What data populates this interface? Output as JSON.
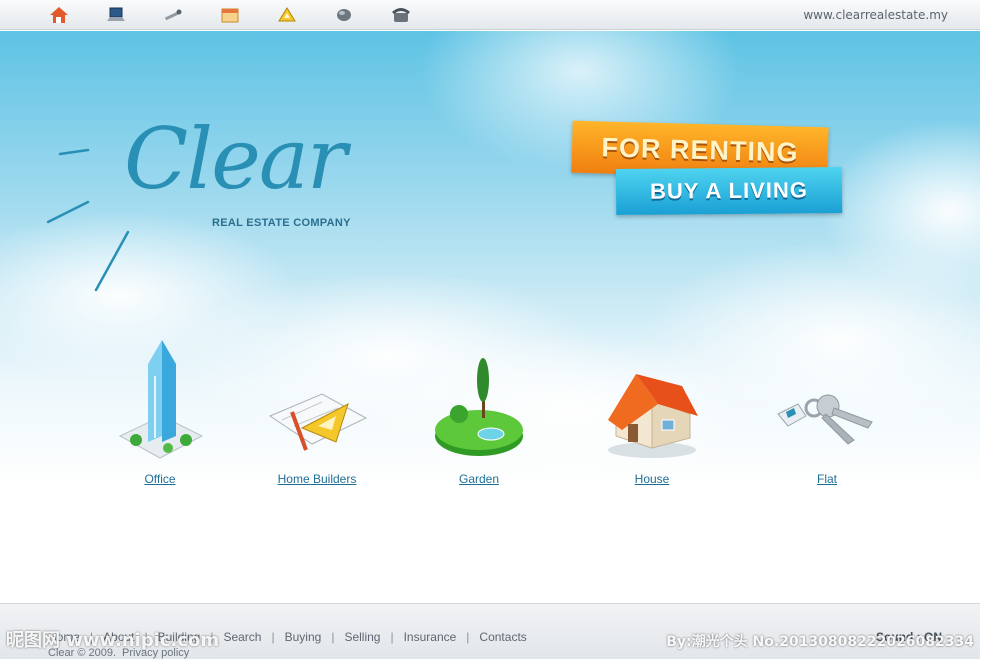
{
  "topbar": {
    "icons": [
      "home-icon",
      "laptop-icon",
      "tools-icon",
      "calendar-icon",
      "ruler-triangle-icon",
      "globe-icon",
      "phone-icon"
    ],
    "url": "www.clearrealestate.my"
  },
  "logo": {
    "word": "Clear",
    "subtitle": "REAL ESTATE COMPANY"
  },
  "banners": {
    "primary": "FOR RENTING",
    "secondary": "BUY A LIVING"
  },
  "categories": [
    {
      "label": "Office",
      "icon": "office-building-icon"
    },
    {
      "label": "Home Builders",
      "icon": "blueprint-icon"
    },
    {
      "label": "Garden",
      "icon": "garden-icon"
    },
    {
      "label": "House",
      "icon": "house-icon"
    },
    {
      "label": "Flat",
      "icon": "keys-icon"
    }
  ],
  "footer": {
    "nav": [
      "Home",
      "About",
      "Building",
      "Search",
      "Buying",
      "Selling",
      "Insurance",
      "Contacts"
    ],
    "copyright": "Clear  ©  2009.",
    "privacy": "Privacy policy",
    "sound": "Sound : ON"
  },
  "watermarks": {
    "left": "昵图网 www.nipic.com",
    "right": "By:潮光个头 No.20130808222026082334"
  },
  "colors": {
    "accent": "#2a8fb5",
    "banner_orange": "#f59a1b",
    "banner_blue": "#2bb3e0",
    "link": "#1f6f95"
  }
}
